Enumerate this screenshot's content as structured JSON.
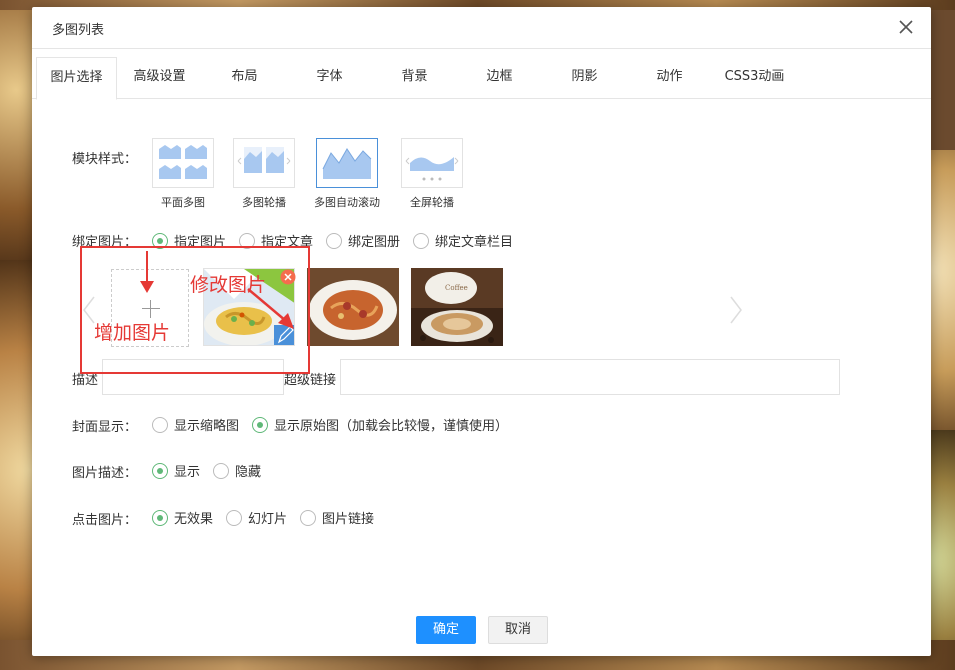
{
  "dialog": {
    "title": "多图列表"
  },
  "tabs": [
    {
      "label": "图片选择",
      "active": true
    },
    {
      "label": "高级设置"
    },
    {
      "label": "布局"
    },
    {
      "label": "字体"
    },
    {
      "label": "背景"
    },
    {
      "label": "边框"
    },
    {
      "label": "阴影"
    },
    {
      "label": "动作"
    },
    {
      "label": "CSS3动画"
    }
  ],
  "module_style": {
    "label": "模块样式：",
    "options": [
      {
        "label": "平面多图"
      },
      {
        "label": "多图轮播"
      },
      {
        "label": "多图自动滚动",
        "selected": true
      },
      {
        "label": "全屏轮播"
      }
    ]
  },
  "bind_image": {
    "label": "绑定图片：",
    "options": [
      {
        "label": "指定图片",
        "checked": true
      },
      {
        "label": "指定文章"
      },
      {
        "label": "绑定图册"
      },
      {
        "label": "绑定文章栏目"
      }
    ]
  },
  "description_field": {
    "label": "描述"
  },
  "link_field": {
    "label": "超级链接"
  },
  "cover_display": {
    "label": "封面显示：",
    "options": [
      {
        "label": "显示缩略图"
      },
      {
        "label": "显示原始图（加载会比较慢，谨慎使用）",
        "checked": true
      }
    ]
  },
  "image_desc": {
    "label": "图片描述：",
    "options": [
      {
        "label": "显示",
        "checked": true
      },
      {
        "label": "隐藏"
      }
    ]
  },
  "click_image": {
    "label": "点击图片：",
    "options": [
      {
        "label": "无效果",
        "checked": true
      },
      {
        "label": "幻灯片"
      },
      {
        "label": "图片链接"
      }
    ]
  },
  "buttons": {
    "confirm": "确定",
    "cancel": "取消"
  },
  "annotations": {
    "add_image": "增加图片",
    "edit_image": "修改图片"
  },
  "colors": {
    "accent": "#1e90ff",
    "radio_on": "#5fb878",
    "annotation": "#e53935"
  }
}
